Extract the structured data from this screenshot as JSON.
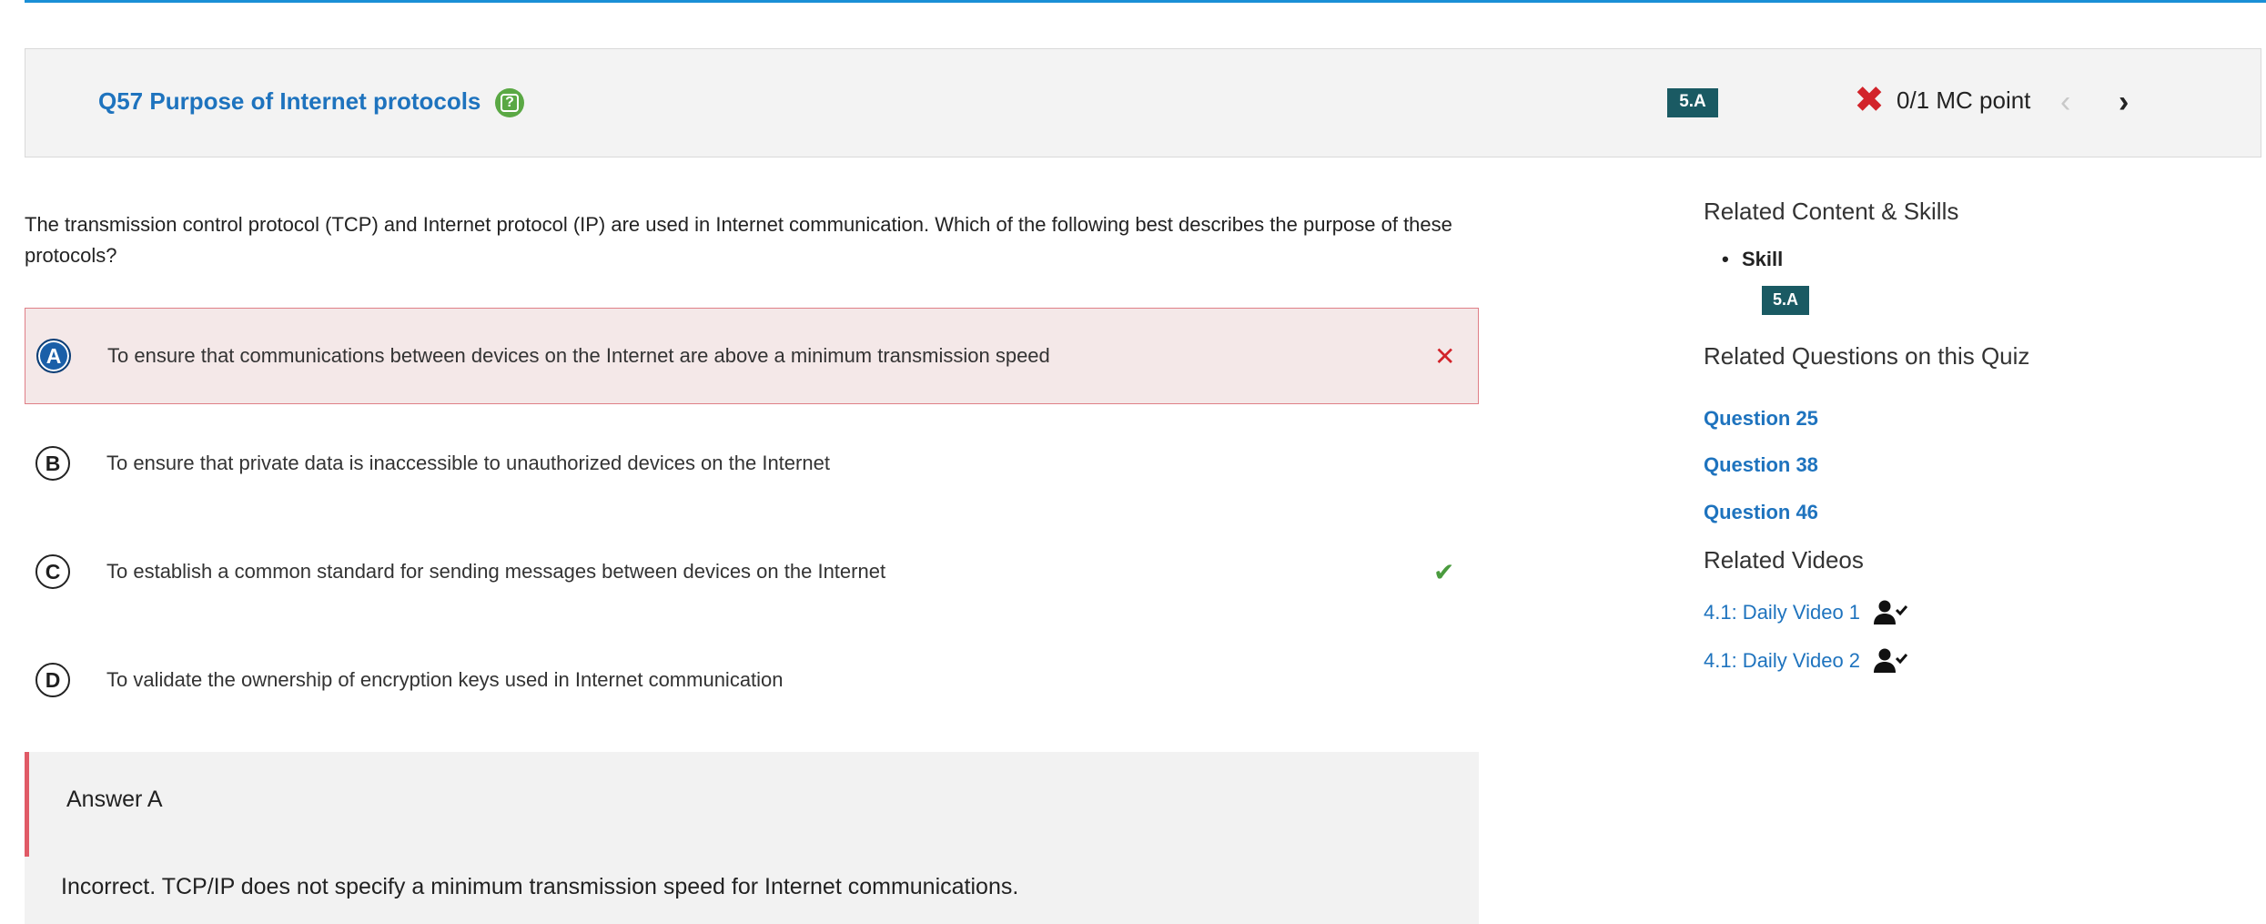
{
  "header": {
    "title": "Q57 Purpose of Internet protocols",
    "skill_badge": "5.A",
    "score_text": "0/1 MC point",
    "prev_glyph": "‹",
    "next_glyph": "›"
  },
  "question": {
    "text": "The transmission control protocol (TCP) and Internet protocol (IP) are used in Internet communication. Which of the following best describes the purpose of these protocols?"
  },
  "choices": [
    {
      "letter": "A",
      "text": "To ensure that communications between devices on the Internet are above a minimum transmission speed",
      "selected": true,
      "result": "incorrect"
    },
    {
      "letter": "B",
      "text": "To ensure that private data is inaccessible to unauthorized devices on the Internet",
      "selected": false,
      "result": ""
    },
    {
      "letter": "C",
      "text": "To establish a common standard for sending messages between devices on the Internet",
      "selected": false,
      "result": "correct"
    },
    {
      "letter": "D",
      "text": "To validate the ownership of encryption keys used in Internet communication",
      "selected": false,
      "result": ""
    }
  ],
  "answer": {
    "title": "Answer A",
    "explanation": "Incorrect. TCP/IP does not specify a minimum transmission speed for Internet communications."
  },
  "sidebar": {
    "related_content_title": "Related Content & Skills",
    "skill_label": "Skill",
    "skill_badge": "5.A",
    "related_questions_title": "Related Questions on this Quiz",
    "questions": [
      "Question 25",
      "Question 38",
      "Question 46"
    ],
    "related_videos_title": "Related Videos",
    "videos": [
      "4.1: Daily Video 1",
      "4.1: Daily Video 2"
    ]
  },
  "colors": {
    "accent_blue": "#1e73be",
    "badge_teal": "#1a5a63",
    "incorrect_red": "#d2232a",
    "correct_green": "#4a9b3e",
    "help_green": "#5aa844"
  },
  "icons": {
    "help": "help-icon",
    "score": "x-mark-icon",
    "prev": "chevron-left-icon",
    "next": "chevron-right-icon",
    "wrong": "x-icon",
    "right": "check-icon",
    "video": "person-check-icon"
  }
}
